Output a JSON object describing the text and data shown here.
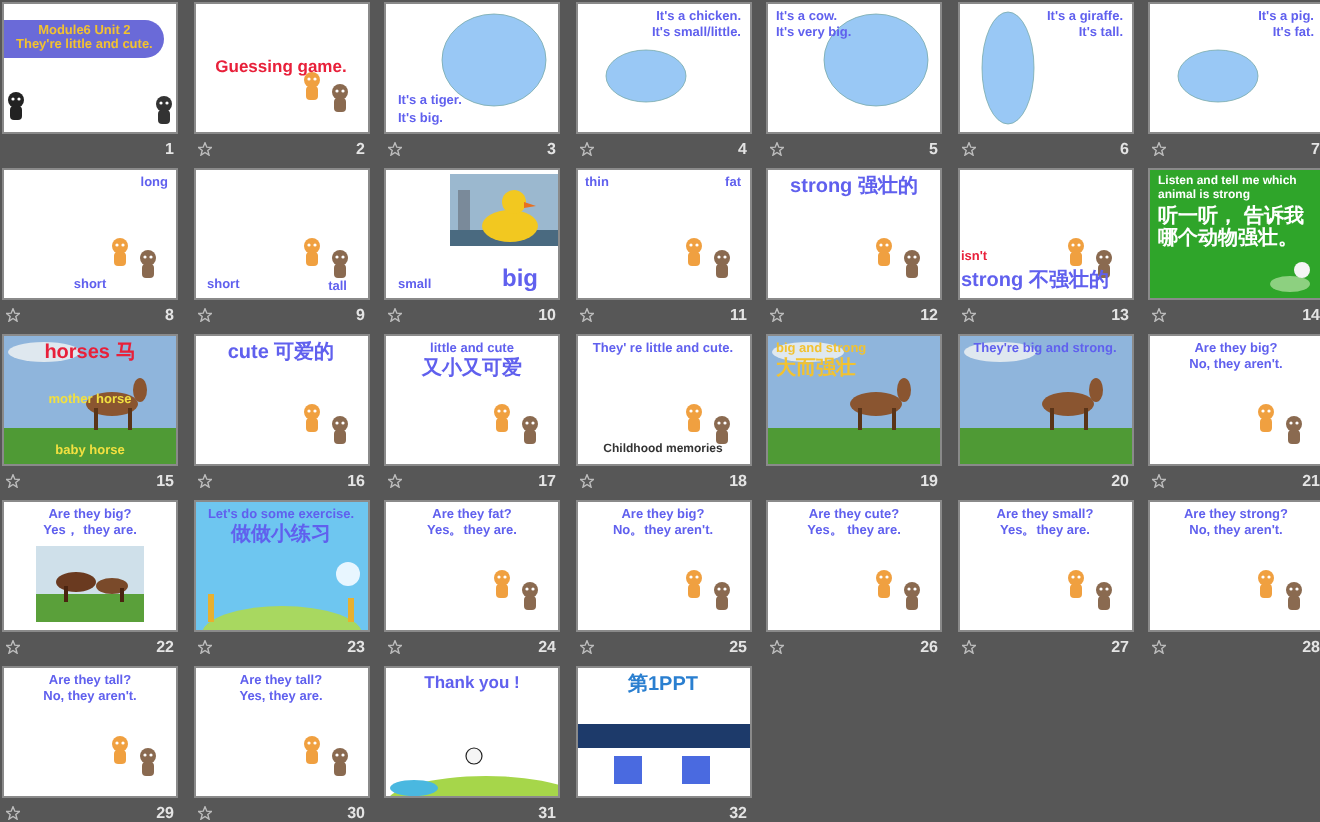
{
  "slides": [
    {
      "number": "1",
      "transition": false,
      "kind": "title",
      "top_left": [
        [
          {
            "text": "Module6  Unit 2",
            "color": "#f2c230",
            "kind": "caption"
          }
        ],
        [
          {
            "text": "They're little and cute.",
            "color": "#f2c230",
            "kind": "caption"
          }
        ]
      ]
    },
    {
      "number": "2",
      "transition": true,
      "kind": "cartoon",
      "center": [
        [
          {
            "text": "Guessing game.",
            "color": "#e8203a",
            "kind": "heading"
          }
        ]
      ]
    },
    {
      "number": "3",
      "transition": true,
      "kind": "ellipse",
      "bottom_left": [
        [
          {
            "text": "It's a tiger.",
            "color": "#6060ee",
            "kind": "caption"
          }
        ],
        [
          {
            "text": "It's big.",
            "color": "#6060ee",
            "kind": "caption"
          }
        ]
      ]
    },
    {
      "number": "4",
      "transition": true,
      "kind": "dot",
      "top_right": [
        [
          {
            "text": "It's a chicken.",
            "color": "#6060ee",
            "kind": "caption"
          }
        ],
        [
          {
            "text": "It's small/little.",
            "color": "#6060ee",
            "kind": "caption"
          }
        ]
      ]
    },
    {
      "number": "5",
      "transition": true,
      "kind": "ellipse",
      "top_left": [
        [
          {
            "text": "It's a cow.",
            "color": "#6060ee",
            "kind": "caption"
          }
        ],
        [
          {
            "text": "It's very big.",
            "color": "#6060ee",
            "kind": "caption"
          }
        ]
      ]
    },
    {
      "number": "6",
      "transition": true,
      "kind": "oval",
      "top_right": [
        [
          {
            "text": "It's a giraffe.",
            "color": "#6060ee",
            "kind": "caption"
          }
        ],
        [
          {
            "text": "It's tall.",
            "color": "#6060ee",
            "kind": "caption"
          }
        ]
      ]
    },
    {
      "number": "7",
      "transition": true,
      "kind": "dot",
      "top_right": [
        [
          {
            "text": "It's a pig.",
            "color": "#6060ee",
            "kind": "caption"
          }
        ],
        [
          {
            "text": "It's fat.",
            "color": "#6060ee",
            "kind": "caption"
          }
        ]
      ]
    },
    {
      "number": "8",
      "transition": true,
      "kind": "cartoon",
      "top_right": [
        [
          {
            "text": "long",
            "color": "#6060ee",
            "kind": "caption"
          }
        ]
      ],
      "bottom": [
        [
          {
            "text": "short",
            "color": "#6060ee",
            "kind": "caption"
          }
        ]
      ]
    },
    {
      "number": "9",
      "transition": true,
      "kind": "cartoon",
      "bottom_left": [
        [
          {
            "text": "short",
            "color": "#6060ee",
            "kind": "caption"
          }
        ]
      ],
      "bottom_right": [
        [
          {
            "text": "tall",
            "color": "#6060ee",
            "kind": "caption"
          }
        ]
      ]
    },
    {
      "number": "10",
      "transition": true,
      "kind": "duck",
      "bottom_left": [
        [
          {
            "text": "small",
            "color": "#6060ee",
            "kind": "caption"
          }
        ]
      ],
      "bottom_right": [
        [
          {
            "text": "big",
            "color": "#6060ee",
            "kind": "heading"
          }
        ]
      ]
    },
    {
      "number": "11",
      "transition": true,
      "kind": "cartoon",
      "top_left": [
        [
          {
            "text": "thin",
            "color": "#6060ee",
            "kind": "caption"
          }
        ]
      ],
      "top_right": [
        [
          {
            "text": "fat",
            "color": "#6060ee",
            "kind": "caption"
          }
        ]
      ]
    },
    {
      "number": "12",
      "transition": true,
      "kind": "cartoon",
      "top": [
        [
          {
            "text": "strong 强壮的",
            "color": "#6060ee",
            "kind": "caption"
          }
        ]
      ]
    },
    {
      "number": "13",
      "transition": true,
      "kind": "cartoon",
      "bottom": [
        [
          {
            "text": "isn't",
            "color": "#e8203a",
            "kind": "caption"
          },
          {
            "text": "strong 不强壮的",
            "color": "#6060ee",
            "kind": "caption"
          }
        ]
      ]
    },
    {
      "number": "14",
      "transition": true,
      "kind": "green",
      "top_left": [
        [
          {
            "text": "Listen and tell me which animal is strong",
            "color": "#ffffff",
            "kind": "note"
          }
        ],
        [
          {
            "text": "听一听， 告诉我哪个动物强壮。",
            "color": "#ffffff",
            "kind": "note"
          }
        ]
      ]
    },
    {
      "number": "15",
      "transition": true,
      "top": [
        [
          {
            "text": "horses 马",
            "color": "#e8203a",
            "kind": "heading"
          }
        ]
      ],
      "center": [
        [
          {
            "text": "mother horse",
            "color": "#f2e040",
            "kind": "caption"
          }
        ]
      ],
      "bottom": [
        [
          {
            "text": "baby horse",
            "color": "#f2e040",
            "kind": "caption"
          }
        ]
      ]
    },
    {
      "number": "16",
      "transition": true,
      "kind": "cartoon",
      "top": [
        [
          {
            "text": "cute 可爱的",
            "color": "#6060ee",
            "kind": "caption"
          }
        ]
      ]
    },
    {
      "number": "17",
      "transition": true,
      "kind": "cartoon",
      "top": [
        [
          {
            "text": "little and cute",
            "color": "#6060ee",
            "kind": "caption"
          }
        ],
        [
          {
            "text": "又小又可爱",
            "color": "#6060ee",
            "kind": "caption"
          }
        ]
      ]
    },
    {
      "number": "18",
      "transition": true,
      "kind": "cartoon",
      "top": [
        [
          {
            "text": "They' re little and cute.",
            "color": "#6060ee",
            "kind": "caption"
          }
        ]
      ],
      "bottom": [
        [
          {
            "text": "Childhood memories",
            "color": "#333333",
            "kind": "note"
          }
        ]
      ]
    },
    {
      "number": "19",
      "transition": false,
      "top_left": [
        [
          {
            "text": "big and strong",
            "color": "#f2c230",
            "kind": "caption"
          }
        ],
        [
          {
            "text": "大而强壮",
            "color": "#f2c230",
            "kind": "caption"
          }
        ]
      ]
    },
    {
      "number": "20",
      "transition": false,
      "top": [
        [
          {
            "text": "They're big and strong.",
            "color": "#6060ee",
            "kind": "caption"
          }
        ]
      ]
    },
    {
      "number": "21",
      "transition": true,
      "kind": "cartoon",
      "top": [
        [
          {
            "text": "Are they big?",
            "color": "#6060ee",
            "kind": "caption"
          }
        ],
        [
          {
            "text": "No, they aren't.",
            "color": "#6060ee",
            "kind": "caption"
          }
        ]
      ]
    },
    {
      "number": "22",
      "transition": true,
      "kind": "inset",
      "top": [
        [
          {
            "text": "Are they big?",
            "color": "#6060ee",
            "kind": "caption"
          }
        ],
        [
          {
            "text": "Yes， they are.",
            "color": "#6060ee",
            "kind": "caption"
          }
        ]
      ]
    },
    {
      "number": "23",
      "transition": true,
      "kind": "sky",
      "top": [
        [
          {
            "text": "Let's do some exercise.",
            "color": "#6060ee",
            "kind": "caption"
          }
        ],
        [
          {
            "text": "做做小练习",
            "color": "#6060ee",
            "kind": "caption"
          }
        ]
      ]
    },
    {
      "number": "24",
      "transition": true,
      "kind": "cartoon",
      "top": [
        [
          {
            "text": "Are they fat?",
            "color": "#6060ee",
            "kind": "caption"
          }
        ],
        [
          {
            "text": "Yes。they are.",
            "color": "#6060ee",
            "kind": "caption"
          }
        ]
      ]
    },
    {
      "number": "25",
      "transition": true,
      "kind": "cartoon",
      "top": [
        [
          {
            "text": "Are they big?",
            "color": "#6060ee",
            "kind": "caption"
          }
        ],
        [
          {
            "text": "No。they aren't.",
            "color": "#6060ee",
            "kind": "caption"
          }
        ]
      ]
    },
    {
      "number": "26",
      "transition": true,
      "kind": "cartoon",
      "top": [
        [
          {
            "text": "Are they cute?",
            "color": "#6060ee",
            "kind": "caption"
          }
        ],
        [
          {
            "text": "Yes。 they are.",
            "color": "#6060ee",
            "kind": "caption"
          }
        ]
      ]
    },
    {
      "number": "27",
      "transition": true,
      "kind": "cartoon",
      "top": [
        [
          {
            "text": "Are they small?",
            "color": "#6060ee",
            "kind": "caption"
          }
        ],
        [
          {
            "text": "Yes。they are.",
            "color": "#6060ee",
            "kind": "caption"
          }
        ]
      ]
    },
    {
      "number": "28",
      "transition": true,
      "kind": "cartoon",
      "top": [
        [
          {
            "text": "Are they strong?",
            "color": "#6060ee",
            "kind": "caption"
          }
        ],
        [
          {
            "text": "No, they aren't.",
            "color": "#6060ee",
            "kind": "caption"
          }
        ]
      ]
    },
    {
      "number": "29",
      "transition": true,
      "kind": "cartoon",
      "top": [
        [
          {
            "text": "Are they tall?",
            "color": "#6060ee",
            "kind": "caption"
          }
        ],
        [
          {
            "text": "No, they aren't.",
            "color": "#6060ee",
            "kind": "caption"
          }
        ]
      ]
    },
    {
      "number": "30",
      "transition": true,
      "kind": "cartoon",
      "top": [
        [
          {
            "text": "Are they tall?",
            "color": "#6060ee",
            "kind": "caption"
          }
        ],
        [
          {
            "text": "Yes, they are.",
            "color": "#6060ee",
            "kind": "caption"
          }
        ]
      ]
    },
    {
      "number": "31",
      "transition": false,
      "kind": "meadow",
      "top": [
        [
          {
            "text": "Thank you !",
            "color": "#6060ee",
            "kind": "heading"
          }
        ]
      ]
    },
    {
      "number": "32",
      "transition": false,
      "kind": "logo",
      "top": [
        [
          {
            "text": "第1PPT",
            "color": "#2a7fd0",
            "kind": "heading"
          }
        ]
      ]
    }
  ]
}
